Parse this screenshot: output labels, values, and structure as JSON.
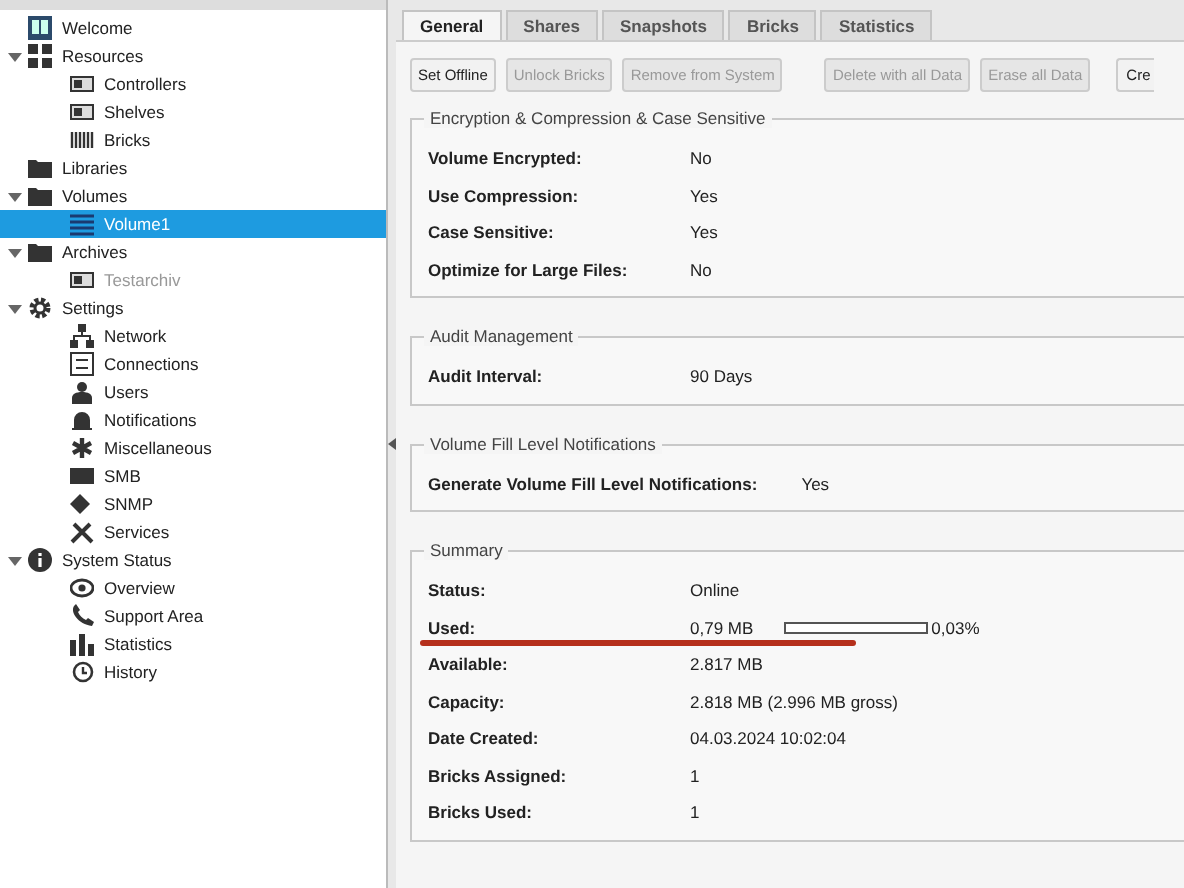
{
  "sidebar": {
    "tree": [
      {
        "label": "Welcome",
        "selected": false,
        "disabled": false
      },
      {
        "label": "Resources",
        "selected": false,
        "disabled": false,
        "expanded": true,
        "children": [
          {
            "label": "Controllers",
            "selected": false,
            "disabled": false
          },
          {
            "label": "Shelves",
            "selected": false,
            "disabled": false
          },
          {
            "label": "Bricks",
            "selected": false,
            "disabled": false
          }
        ]
      },
      {
        "label": "Libraries",
        "selected": false,
        "disabled": false
      },
      {
        "label": "Volumes",
        "selected": false,
        "disabled": false,
        "expanded": true,
        "children": [
          {
            "label": "Volume1",
            "selected": true,
            "disabled": false
          }
        ]
      },
      {
        "label": "Archives",
        "selected": false,
        "disabled": false,
        "expanded": true,
        "children": [
          {
            "label": "Testarchiv",
            "selected": false,
            "disabled": true
          }
        ]
      },
      {
        "label": "Settings",
        "selected": false,
        "disabled": false,
        "expanded": true,
        "children": [
          {
            "label": "Network",
            "selected": false,
            "disabled": false
          },
          {
            "label": "Connections",
            "selected": false,
            "disabled": false
          },
          {
            "label": "Users",
            "selected": false,
            "disabled": false
          },
          {
            "label": "Notifications",
            "selected": false,
            "disabled": false
          },
          {
            "label": "Miscellaneous",
            "selected": false,
            "disabled": false
          },
          {
            "label": "SMB",
            "selected": false,
            "disabled": false
          },
          {
            "label": "SNMP",
            "selected": false,
            "disabled": false
          },
          {
            "label": "Services",
            "selected": false,
            "disabled": false
          }
        ]
      },
      {
        "label": "System Status",
        "selected": false,
        "disabled": false,
        "expanded": true,
        "children": [
          {
            "label": "Overview",
            "selected": false,
            "disabled": false
          },
          {
            "label": "Support Area",
            "selected": false,
            "disabled": false
          },
          {
            "label": "Statistics",
            "selected": false,
            "disabled": false
          },
          {
            "label": "History",
            "selected": false,
            "disabled": false
          }
        ]
      }
    ]
  },
  "tabs": [
    {
      "label": "General",
      "selected": true
    },
    {
      "label": "Shares",
      "selected": false
    },
    {
      "label": "Snapshots",
      "selected": false
    },
    {
      "label": "Bricks",
      "selected": false
    },
    {
      "label": "Statistics",
      "selected": false
    }
  ],
  "toolbar": [
    {
      "label": "Set Offline",
      "disabled": false
    },
    {
      "label": "Unlock Bricks",
      "disabled": true
    },
    {
      "label": "Remove from System",
      "disabled": true
    },
    {
      "label": "Delete with all Data",
      "disabled": true
    },
    {
      "label": "Erase all Data",
      "disabled": true
    },
    {
      "label": "Cre",
      "disabled": false
    }
  ],
  "sections": [
    {
      "title": "Encryption & Compression & Case Sensitive",
      "rows": [
        {
          "label": "Volume Encrypted:",
          "value": "No"
        },
        {
          "label": "Use Compression:",
          "value": "Yes"
        },
        {
          "label": "Case Sensitive:",
          "value": "Yes"
        },
        {
          "label": "Optimize for Large Files:",
          "value": "No"
        }
      ]
    },
    {
      "title": "Audit Management",
      "rows": [
        {
          "label": "Audit Interval:",
          "value": "90 Days"
        }
      ]
    },
    {
      "title": "Volume Fill Level Notifications",
      "rows": [
        {
          "label": "Generate Volume Fill Level Notifications:",
          "value": "Yes"
        }
      ]
    },
    {
      "title": "Summary",
      "rows": [
        {
          "label": "Status:",
          "value": "Online"
        },
        {
          "label": "Used:",
          "value": "0,79 MB",
          "level": 0.0003,
          "reading": "0,03%",
          "underlined": true
        },
        {
          "label": "Available:",
          "value": "2.817 MB"
        },
        {
          "label": "Capacity:",
          "value": "2.818 MB (2.996 MB gross)"
        },
        {
          "label": "Date Created:",
          "value": "04.03.2024 10:02:04"
        },
        {
          "label": "Bricks Assigned:",
          "value": "1"
        },
        {
          "label": "Bricks Used:",
          "value": "1"
        }
      ]
    }
  ]
}
